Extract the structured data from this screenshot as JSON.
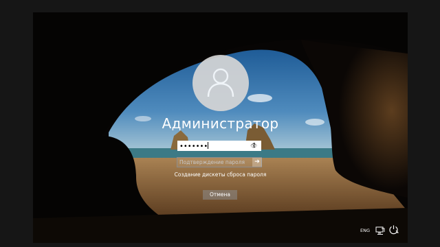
{
  "login": {
    "username": "Администратор",
    "password_value": "•••••••",
    "confirm_placeholder": "Подтверждение пароля",
    "reset_link": "Создание дискеты сброса пароля",
    "cancel_label": "Отмена"
  },
  "taskbar": {
    "language": "ENG",
    "network_icon": "network-icon",
    "power_icon": "power-icon"
  },
  "icons": {
    "avatar": "user-avatar-icon",
    "reveal": "eye-reveal-icon",
    "submit": "arrow-right-icon"
  },
  "colors": {
    "sky": "#2f6ea6",
    "sea": "#3c7a86",
    "sand": "#b38a5a",
    "cave": "#0a0806"
  }
}
